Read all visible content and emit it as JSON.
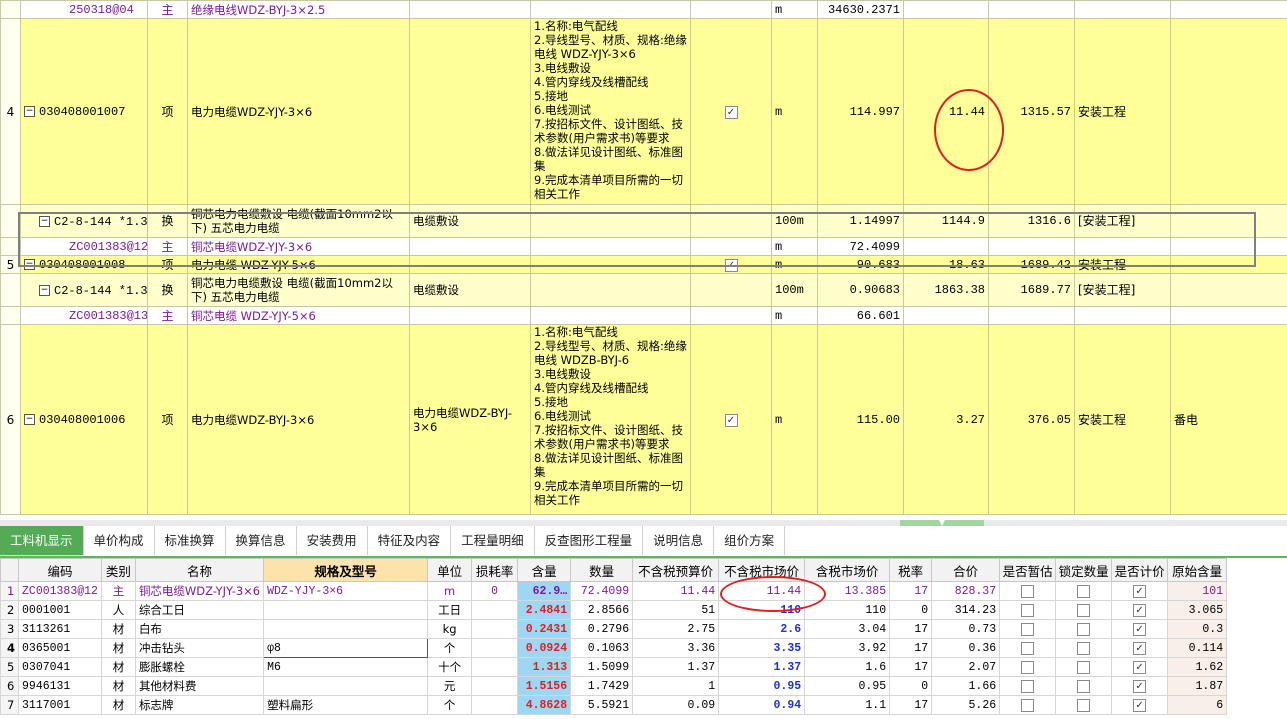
{
  "upper": {
    "rows": [
      {
        "kind": "material",
        "idx": "",
        "code": "250318@04",
        "type": "主",
        "name": "绝缘电线WDZ-BYJ-3×2.5",
        "unit": "m",
        "qty": "34630.2371"
      },
      {
        "kind": "item",
        "idx": "4",
        "code": "030408001007",
        "type": "项",
        "name": "电力电缆WDZ-YJY-3×6",
        "desc": "1.名称:电气配线\n2.导线型号、材质、规格:绝缘电线 WDZ-YJY-3×6\n3.电线敷设\n4.管内穿线及线槽配线\n5.接地\n6.电线测试\n7.按招标文件、设计图纸、技术参数(用户需求书)等要求\n8.做法详见设计图纸、标准图集\n9.完成本清单项目所需的一切相关工作",
        "feature": "",
        "unit": "m",
        "qty": "114.997",
        "price": "11.44",
        "total": "1315.57",
        "category": "安装工程",
        "note": ""
      },
      {
        "kind": "quota",
        "idx": "",
        "code": "C2-8-144 *1.3",
        "type": "换",
        "name": "铜芯电力电缆敷设 电缆(截面10mm2以下) 五芯电力电缆",
        "feature": "电缆敷设",
        "unit": "100m",
        "qty": "1.14997",
        "price": "1144.9",
        "total": "1316.6",
        "category": "[安装工程]"
      },
      {
        "kind": "material",
        "idx": "",
        "code": "ZC001383@12",
        "type": "主",
        "name": "铜芯电缆WDZ-YJY-3×6",
        "unit": "m",
        "qty": "72.4099"
      },
      {
        "kind": "item5",
        "idx": "5",
        "code": "030408001008",
        "type": "项",
        "name": "电力电缆 WDZ-YJY-5×6",
        "unit": "m",
        "qty": "90.683",
        "price": "18.63",
        "total": "1689.42",
        "category": "安装工程"
      },
      {
        "kind": "quota",
        "idx": "",
        "code": "C2-8-144 *1.3",
        "type": "换",
        "name": "铜芯电力电缆敷设 电缆(截面10mm2以下) 五芯电力电缆",
        "feature": "电缆敷设",
        "unit": "100m",
        "qty": "0.90683",
        "price": "1863.38",
        "total": "1689.77",
        "category": "[安装工程]"
      },
      {
        "kind": "material",
        "idx": "",
        "code": "ZC001383@13",
        "type": "主",
        "name": "铜芯电缆 WDZ-YJY-5×6",
        "unit": "m",
        "qty": "66.601"
      },
      {
        "kind": "item",
        "idx": "6",
        "code": "030408001006",
        "type": "项",
        "name": "电力电缆WDZ-BYJ-3×6",
        "desc": "1.名称:电气配线\n2.导线型号、材质、规格:绝缘电线 WDZB-BYJ-6\n3.电线敷设\n4.管内穿线及线槽配线\n5.接地\n6.电线测试\n7.按招标文件、设计图纸、技术参数(用户需求书)等要求\n8.做法详见设计图纸、标准图集\n9.完成本清单项目所需的一切相关工作",
        "feature": "电力电缆WDZ-BYJ-3×6",
        "unit": "m",
        "qty": "115.00",
        "price": "3.27",
        "total": "376.05",
        "category": "安装工程",
        "note": "番电"
      }
    ]
  },
  "tabs": [
    "工料机显示",
    "单价构成",
    "标准换算",
    "换算信息",
    "安装费用",
    "特征及内容",
    "工程量明细",
    "反查图形工程量",
    "说明信息",
    "组价方案"
  ],
  "active_tab": 0,
  "lower": {
    "headers": [
      "",
      "编码",
      "类别",
      "名称",
      "规格及型号",
      "单位",
      "损耗率",
      "含量",
      "数量",
      "不含税预算价",
      "不含税市场价",
      "含税市场价",
      "税率",
      "合价",
      "是否暂估",
      "锁定数量",
      "是否计价",
      "原始含量"
    ],
    "rows": [
      {
        "n": "1",
        "code": "ZC001383@12",
        "type": "主",
        "name": "铜芯电缆WDZ-YJY-3×6",
        "spec": "WDZ-YJY-3×6",
        "unit": "m",
        "loss": "0",
        "content": "62.9…",
        "qty": "72.4099",
        "budget": "11.44",
        "market": "11.44",
        "market_tax": "13.385",
        "tax": "17",
        "total": "828.37",
        "est": false,
        "lock": false,
        "priced": true,
        "orig": "101"
      },
      {
        "n": "2",
        "code": "0001001",
        "type": "人",
        "name": "综合工日",
        "spec": "",
        "unit": "工日",
        "loss": "",
        "content": "2.4841",
        "qty": "2.8566",
        "budget": "51",
        "market": "110",
        "market_tax": "110",
        "tax": "0",
        "total": "314.23",
        "est": false,
        "lock": false,
        "priced": true,
        "orig": "3.065"
      },
      {
        "n": "3",
        "code": "3113261",
        "type": "材",
        "name": "白布",
        "spec": "",
        "unit": "kg",
        "loss": "",
        "content": "0.2431",
        "qty": "0.2796",
        "budget": "2.75",
        "market": "2.6",
        "market_tax": "3.04",
        "tax": "17",
        "total": "0.73",
        "est": false,
        "lock": false,
        "priced": true,
        "orig": "0.3"
      },
      {
        "n": "4",
        "code": "0365001",
        "type": "材",
        "name": "冲击钻头",
        "spec": "φ8",
        "unit": "个",
        "loss": "",
        "content": "0.0924",
        "qty": "0.1063",
        "budget": "3.36",
        "market": "3.35",
        "market_tax": "3.92",
        "tax": "17",
        "total": "0.36",
        "est": false,
        "lock": false,
        "priced": true,
        "orig": "0.114"
      },
      {
        "n": "5",
        "code": "0307041",
        "type": "材",
        "name": "膨胀螺栓",
        "spec": "M6",
        "unit": "十个",
        "loss": "",
        "content": "1.313",
        "qty": "1.5099",
        "budget": "1.37",
        "market": "1.37",
        "market_tax": "1.6",
        "tax": "17",
        "total": "2.07",
        "est": false,
        "lock": false,
        "priced": true,
        "orig": "1.62"
      },
      {
        "n": "6",
        "code": "9946131",
        "type": "材",
        "name": "其他材料费",
        "spec": "",
        "unit": "元",
        "loss": "",
        "content": "1.5156",
        "qty": "1.7429",
        "budget": "1",
        "market": "0.95",
        "market_tax": "0.95",
        "tax": "0",
        "total": "1.66",
        "est": false,
        "lock": false,
        "priced": true,
        "orig": "1.87"
      },
      {
        "n": "7",
        "code": "3117001",
        "type": "材",
        "name": "标志牌",
        "spec": "塑料扁形",
        "unit": "个",
        "loss": "",
        "content": "4.8628",
        "qty": "5.5921",
        "budget": "0.09",
        "market": "0.94",
        "market_tax": "1.1",
        "tax": "17",
        "total": "5.26",
        "est": false,
        "lock": false,
        "priced": true,
        "orig": "6"
      }
    ]
  },
  "colors": {
    "item_row": "#ffff99",
    "sub_row": "#ffffcc",
    "tab_active": "#55aa55",
    "qty_cell": "#9dd7f3",
    "highlight_text": "#e02020",
    "blue_text": "#1c31d6",
    "purple_text": "#7a1a9a",
    "annotation_ring": "#e02020"
  },
  "icons": {
    "expand": "minus-box-icon",
    "check": "checkbox-checked-icon",
    "splitter": "chevron-down-icon"
  }
}
